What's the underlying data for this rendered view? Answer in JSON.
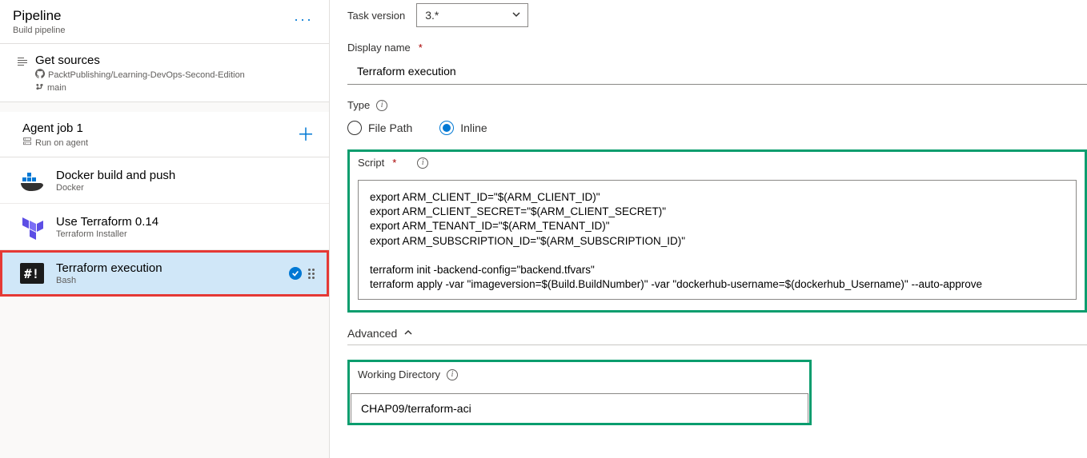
{
  "left": {
    "pipeline_title": "Pipeline",
    "pipeline_sub": "Build pipeline",
    "sources": {
      "title": "Get sources",
      "repo": "PacktPublishing/Learning-DevOps-Second-Edition",
      "branch": "main"
    },
    "job": {
      "title": "Agent job 1",
      "sub": "Run on agent"
    },
    "tasks": [
      {
        "title": "Docker build and push",
        "sub": "Docker"
      },
      {
        "title": "Use Terraform 0.14",
        "sub": "Terraform Installer"
      },
      {
        "title": "Terraform execution",
        "sub": "Bash"
      }
    ]
  },
  "right": {
    "task_version_label": "Task version",
    "task_version_value": "3.*",
    "display_name_label": "Display name",
    "display_name_value": "Terraform execution",
    "type_label": "Type",
    "type_options": {
      "file_path": "File Path",
      "inline": "Inline"
    },
    "script_label": "Script",
    "script_value": "export ARM_CLIENT_ID=\"$(ARM_CLIENT_ID)\"\nexport ARM_CLIENT_SECRET=\"$(ARM_CLIENT_SECRET)\"\nexport ARM_TENANT_ID=\"$(ARM_TENANT_ID)\"\nexport ARM_SUBSCRIPTION_ID=\"$(ARM_SUBSCRIPTION_ID)\"\n\nterraform init -backend-config=\"backend.tfvars\"\nterraform apply -var \"imageversion=$(Build.BuildNumber)\" -var \"dockerhub-username=$(dockerhub_Username)\" --auto-approve",
    "advanced_label": "Advanced",
    "working_dir_label": "Working Directory",
    "working_dir_value": "CHAP09/terraform-aci"
  }
}
